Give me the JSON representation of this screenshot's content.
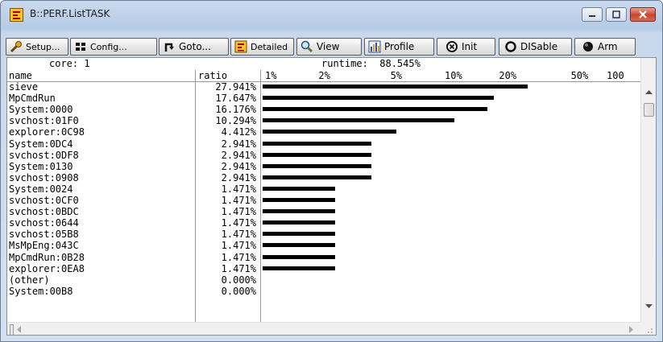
{
  "window": {
    "title": "B::PERF.ListTASK"
  },
  "toolbar": {
    "setup": "Setup...",
    "config": "Config...",
    "goto": "Goto...",
    "detailed": "Detailed",
    "view": "View",
    "profile": "Profile",
    "init": "Init",
    "disable": "DISable",
    "arm": "Arm"
  },
  "summary": {
    "core": "core: 1",
    "runtime": "runtime:  88.545%"
  },
  "columns": {
    "name": "name",
    "ratio": "ratio"
  },
  "scale_ticks": [
    "1%",
    "2%",
    "5%",
    "10%",
    "20%",
    "50%",
    "100"
  ],
  "tasks": [
    {
      "name": "sieve",
      "ratio": "27.941%",
      "value": 27.941
    },
    {
      "name": "MpCmdRun",
      "ratio": "17.647%",
      "value": 17.647
    },
    {
      "name": "System:0000",
      "ratio": "16.176%",
      "value": 16.176
    },
    {
      "name": "svchost:01F0",
      "ratio": "10.294%",
      "value": 10.294
    },
    {
      "name": "explorer:0C98",
      "ratio": "4.412%",
      "value": 4.412
    },
    {
      "name": "System:0DC4",
      "ratio": "2.941%",
      "value": 2.941
    },
    {
      "name": "svchost:0DF8",
      "ratio": "2.941%",
      "value": 2.941
    },
    {
      "name": "System:0130",
      "ratio": "2.941%",
      "value": 2.941
    },
    {
      "name": "svchost:0908",
      "ratio": "2.941%",
      "value": 2.941
    },
    {
      "name": "System:0024",
      "ratio": "1.471%",
      "value": 1.471
    },
    {
      "name": "svchost:0CF0",
      "ratio": "1.471%",
      "value": 1.471
    },
    {
      "name": "svchost:0BDC",
      "ratio": "1.471%",
      "value": 1.471
    },
    {
      "name": "svchost:0644",
      "ratio": "1.471%",
      "value": 1.471
    },
    {
      "name": "svchost:05B8",
      "ratio": "1.471%",
      "value": 1.471
    },
    {
      "name": "MsMpEng:043C",
      "ratio": "1.471%",
      "value": 1.471
    },
    {
      "name": "MpCmdRun:0B28",
      "ratio": "1.471%",
      "value": 1.471
    },
    {
      "name": "explorer:0EA8",
      "ratio": "1.471%",
      "value": 1.471
    },
    {
      "name": "(other)",
      "ratio": "0.000%",
      "value": 0
    },
    {
      "name": "System:00B8",
      "ratio": "0.000%",
      "value": 0
    }
  ],
  "colors": {
    "bar": "#000000",
    "close": "#c84631",
    "title_bg": "#c4d5ec"
  }
}
